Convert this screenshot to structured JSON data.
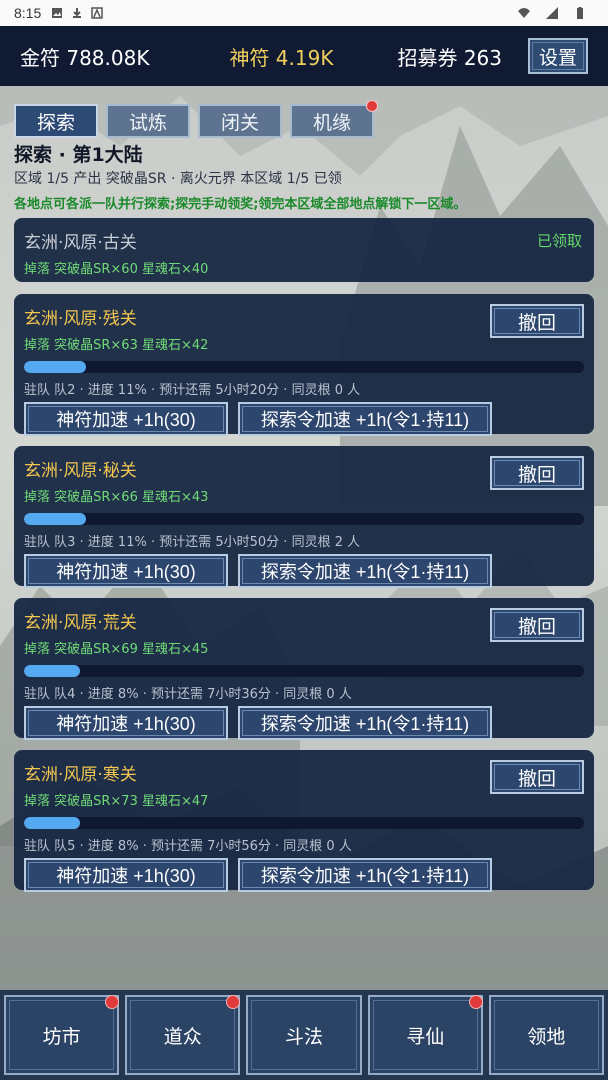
{
  "statusbar": {
    "time": "8:15"
  },
  "header": {
    "gold_label": "金符 788.08K",
    "god_label": "神符 4.19K",
    "ticket_label": "招募券 263",
    "settings_label": "设置"
  },
  "tabs": [
    {
      "label": "探索",
      "active": true,
      "dot": false
    },
    {
      "label": "试炼",
      "active": false,
      "dot": false
    },
    {
      "label": "闭关",
      "active": false,
      "dot": false
    },
    {
      "label": "机缘",
      "active": false,
      "dot": true
    }
  ],
  "explore": {
    "title": "探索 · 第1大陆",
    "region_info": "区域 1/5   产出 突破晶SR · 离火元界   本区域 1/5 已领",
    "hint": "各地点可各派一队并行探索;探完手动领奖;领完本区域全部地点解锁下一区域。"
  },
  "claimed_card": {
    "title": "玄洲·风原·古关",
    "drops": "掉落 突破晶SR×60  星魂石×40",
    "status": "已领取"
  },
  "cards": [
    {
      "title": "玄洲·风原·残关",
      "drops": "掉落 突破晶SR×63  星魂石×42",
      "progress": 0.11,
      "status": "驻队 队2 · 进度 11% · 预计还需 5小时20分 · 同灵根 0 人",
      "recall": "撤回",
      "speed_god": "神符加速 +1h(30)",
      "speed_token": "探索令加速 +1h(令1·持11)"
    },
    {
      "title": "玄洲·风原·秘关",
      "drops": "掉落 突破晶SR×66  星魂石×43",
      "progress": 0.11,
      "status": "驻队 队3 · 进度 11% · 预计还需 5小时50分 · 同灵根 2 人",
      "recall": "撤回",
      "speed_god": "神符加速 +1h(30)",
      "speed_token": "探索令加速 +1h(令1·持11)"
    },
    {
      "title": "玄洲·风原·荒关",
      "drops": "掉落 突破晶SR×69  星魂石×45",
      "progress": 0.08,
      "status": "驻队 队4 · 进度 8% · 预计还需 7小时36分 · 同灵根 0 人",
      "recall": "撤回",
      "speed_god": "神符加速 +1h(30)",
      "speed_token": "探索令加速 +1h(令1·持11)"
    },
    {
      "title": "玄洲·风原·寒关",
      "drops": "掉落 突破晶SR×73  星魂石×47",
      "progress": 0.08,
      "status": "驻队 队5 · 进度 8% · 预计还需 7小时56分 · 同灵根 0 人",
      "recall": "撤回",
      "speed_god": "神符加速 +1h(30)",
      "speed_token": "探索令加速 +1h(令1·持11)"
    }
  ],
  "bottomnav": [
    {
      "label": "坊市",
      "dot": true
    },
    {
      "label": "道众",
      "dot": true
    },
    {
      "label": "斗法",
      "dot": false
    },
    {
      "label": "寻仙",
      "dot": true
    },
    {
      "label": "领地",
      "dot": false
    }
  ]
}
